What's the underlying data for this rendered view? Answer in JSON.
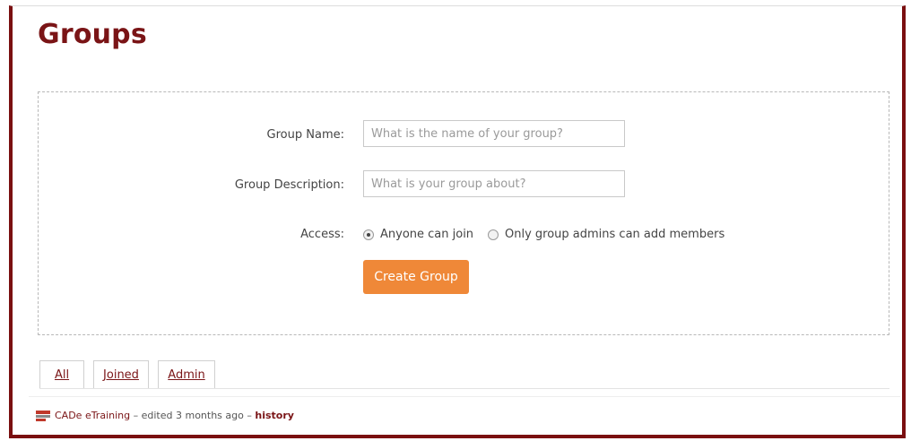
{
  "page": {
    "title": "Groups"
  },
  "form": {
    "name_label": "Group Name:",
    "name_placeholder": "What is the name of your group?",
    "name_value": "",
    "description_label": "Group Description:",
    "description_placeholder": "What is your group about?",
    "description_value": "",
    "access_label": "Access:",
    "access_options": [
      {
        "label": "Anyone can join",
        "selected": true
      },
      {
        "label": "Only group admins can add members",
        "selected": false
      }
    ],
    "submit_label": "Create Group"
  },
  "tabs": [
    {
      "label": "All",
      "active": true
    },
    {
      "label": "Joined",
      "active": false
    },
    {
      "label": "Admin",
      "active": false
    }
  ],
  "footer": {
    "author": "CADe eTraining",
    "edited_text": " – edited 3 months ago – ",
    "history_label": "history"
  },
  "colors": {
    "brand": "#7a1416",
    "button": "#ef8838"
  }
}
